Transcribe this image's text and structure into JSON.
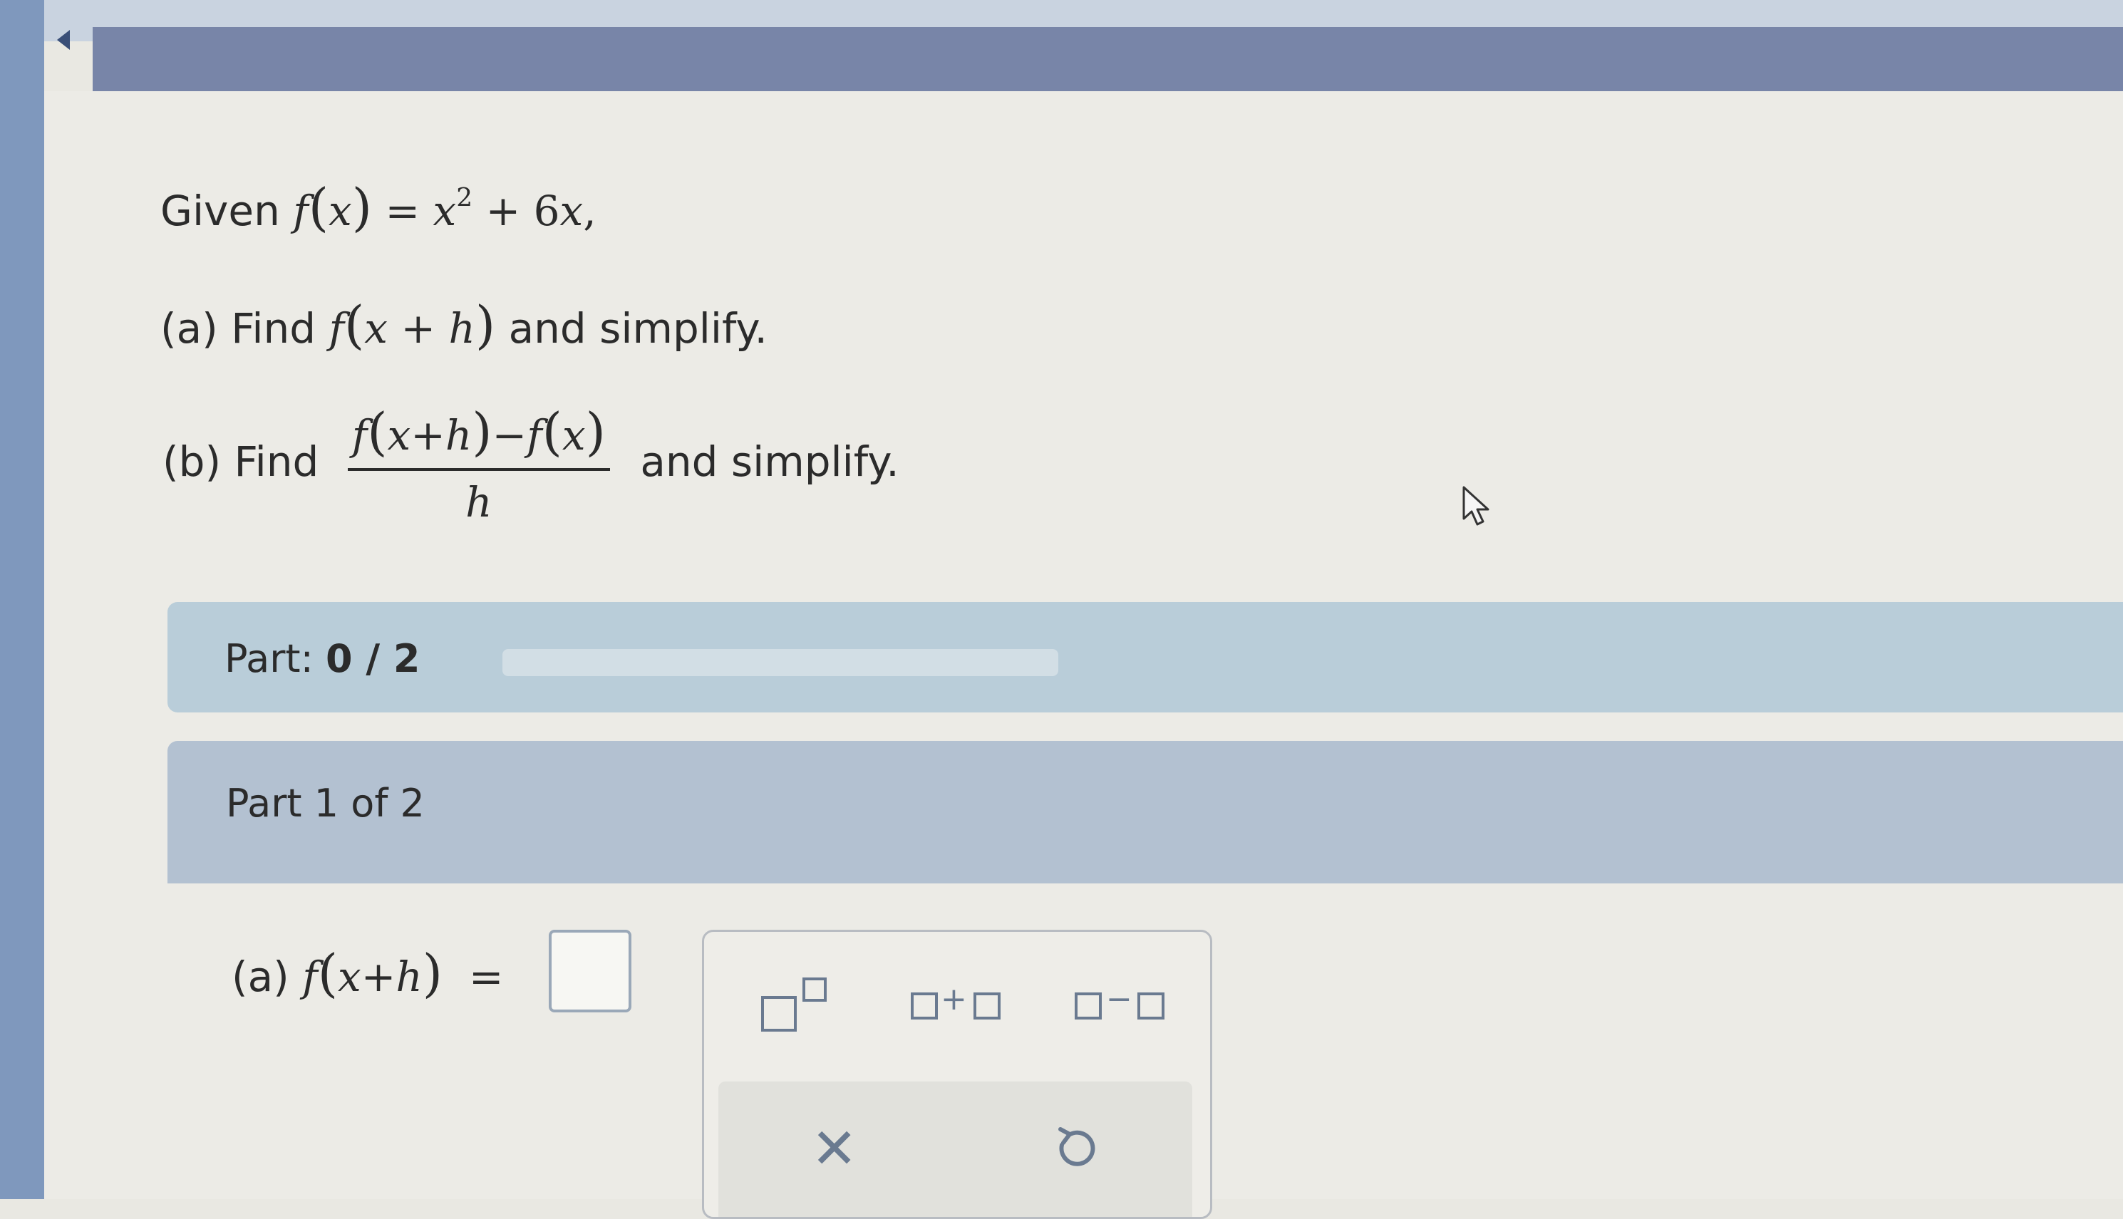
{
  "problem": {
    "given_label": "Given",
    "part_a_label": "(a) Find",
    "part_b_label": "(b) Find",
    "and_simplify": "and simplify."
  },
  "progress": {
    "label": "Part:",
    "value": "0 / 2",
    "completed": 0,
    "total": 2
  },
  "part1": {
    "title": "Part 1 of 2",
    "answer_label": "(a)",
    "answer_value": ""
  },
  "icons": {
    "back": "left-triangle-icon",
    "cursor": "mouse-pointer-icon",
    "superscript": "superscript-template-icon",
    "addition": "addition-template-icon",
    "subtraction": "subtraction-template-icon",
    "clear": "x-icon",
    "undo": "undo-icon"
  },
  "colors": {
    "sidebar": "#7f98bd",
    "header": "#7885a8",
    "part_banner": "#b9cdd9",
    "part1_banner": "#b3c1d1",
    "icon": "#6a7a90"
  }
}
